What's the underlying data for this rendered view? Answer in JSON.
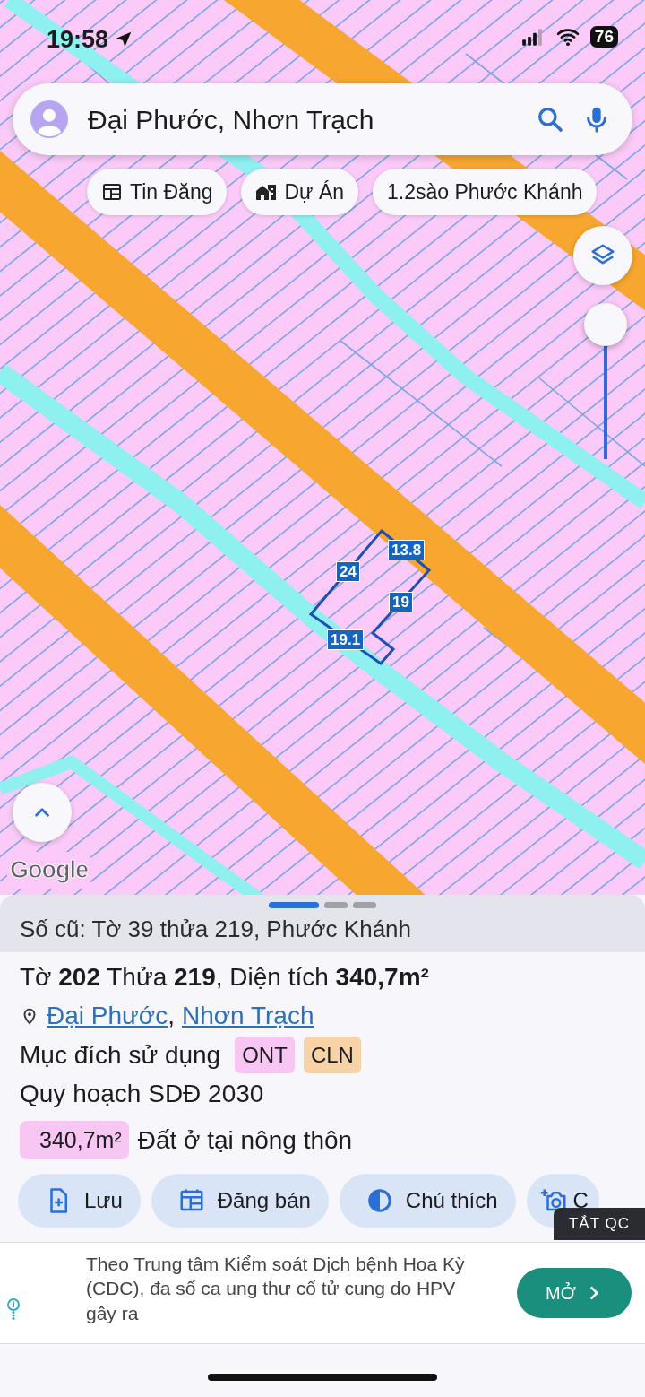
{
  "status_bar": {
    "time": "19:58",
    "battery": "76"
  },
  "search": {
    "value": "Đại Phước, Nhơn Trạch"
  },
  "chips": [
    {
      "kind": "listings",
      "label": "Tin Đăng"
    },
    {
      "kind": "projects",
      "label": "Dự Án"
    },
    {
      "kind": "text",
      "label": "1.2sào Phước Khánh"
    }
  ],
  "map": {
    "parcel_edges": [
      "13.8",
      "24",
      "19",
      "19.1"
    ],
    "zoom_slider": {
      "level": 1
    },
    "attribution": "Google"
  },
  "sheet": {
    "pages": [
      {
        "selected": true
      },
      {
        "selected": false
      },
      {
        "selected": false
      }
    ],
    "old_number": "Số cũ: Tờ 39 thửa 219, Phước Khánh",
    "title": "Tờ **202** Thửa **219**, Diện tích **340,7m²**",
    "location": {
      "parts": [
        "Đại Phước",
        "Nhơn Trạch"
      ],
      "separator": ","
    },
    "usage_label": "Mục đích sử dụng",
    "usage_tags": [
      {
        "label": "ONT",
        "color": "#f7c6f3"
      },
      {
        "label": "CLN",
        "color": "#f8d3a8"
      }
    ],
    "plan_title": "Quy hoạch SDĐ 2030",
    "plan_items": [
      {
        "area": "340,7m²",
        "color": "#f7c6f3",
        "label": "Đất ở tại nông thôn"
      }
    ],
    "actions": [
      {
        "kind": "save",
        "label": "Lưu"
      },
      {
        "kind": "post",
        "label": "Đăng bán"
      },
      {
        "kind": "legend",
        "label": "Chú thích"
      },
      {
        "kind": "camera",
        "label": "C"
      }
    ]
  },
  "ad": {
    "close_label": "TẮT QC",
    "text": "Theo Trung tâm Kiểm soát Dịch bệnh Hoa Kỳ (CDC), đa số ca ung thư cổ tử cung do HPV gây ra",
    "button": "MỞ"
  }
}
